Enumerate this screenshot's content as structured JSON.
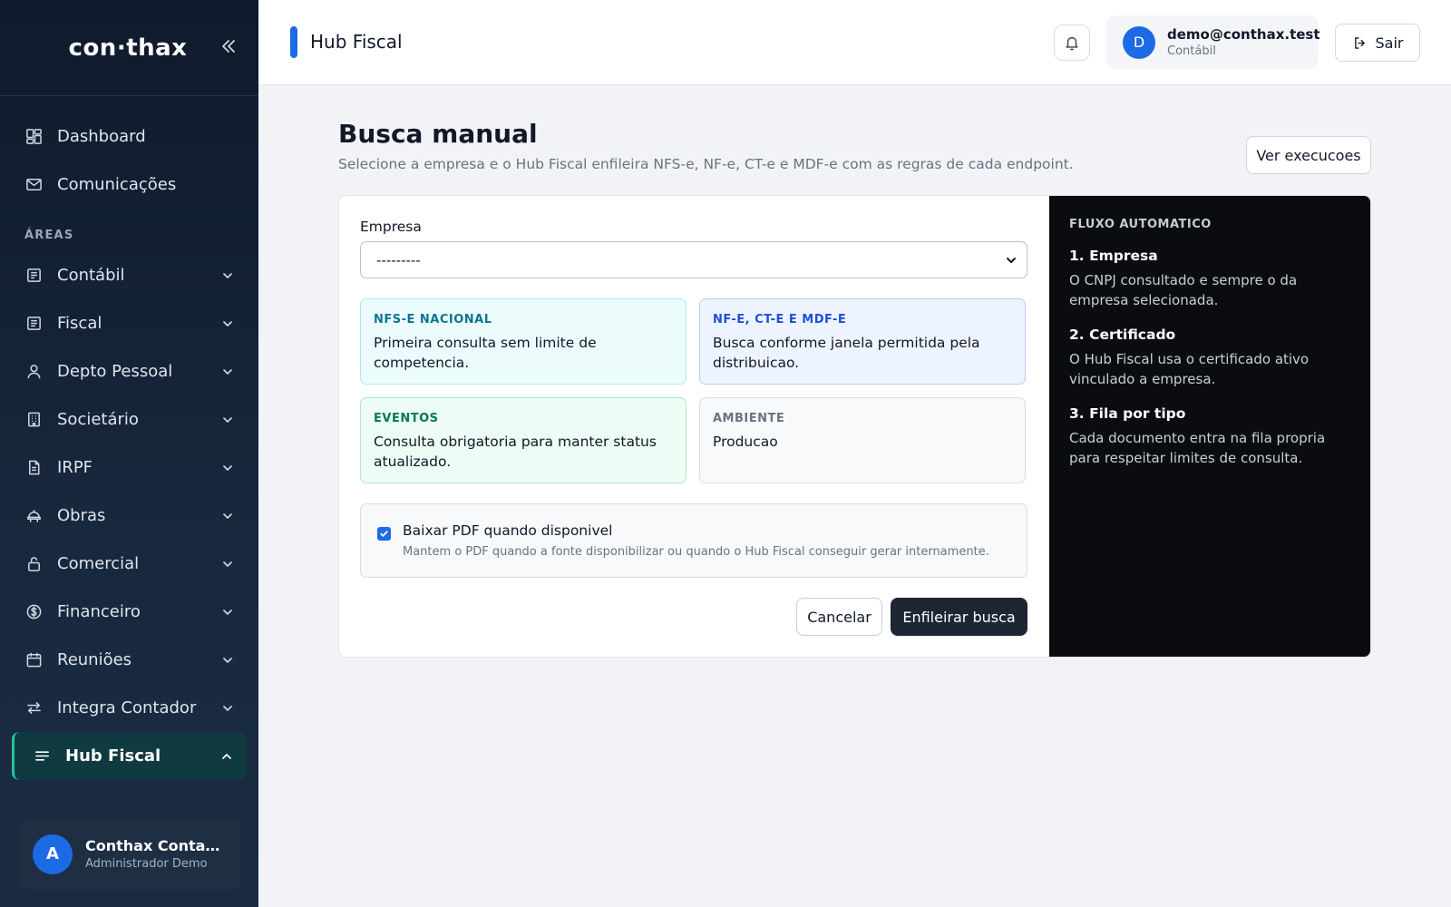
{
  "brand": {
    "logo": "con·thax"
  },
  "sidebar": {
    "top_items": [
      {
        "label": "Dashboard",
        "icon": "dashboard-icon"
      },
      {
        "label": "Comunicações",
        "icon": "mail-icon"
      }
    ],
    "section_label": "ÁREAS",
    "items": [
      {
        "label": "Contábil",
        "icon": "ledger-icon"
      },
      {
        "label": "Fiscal",
        "icon": "receipt-icon"
      },
      {
        "label": "Depto Pessoal",
        "icon": "user-icon"
      },
      {
        "label": "Societário",
        "icon": "building-icon"
      },
      {
        "label": "IRPF",
        "icon": "document-icon"
      },
      {
        "label": "Obras",
        "icon": "construction-icon"
      },
      {
        "label": "Comercial",
        "icon": "lock-icon"
      },
      {
        "label": "Financeiro",
        "icon": "dollar-icon"
      },
      {
        "label": "Reuniões",
        "icon": "calendar-icon"
      },
      {
        "label": "Integra Contador",
        "icon": "transfer-icon"
      }
    ],
    "active_item": {
      "label": "Hub Fiscal",
      "icon": "menu-lines-icon"
    },
    "user": {
      "initial": "A",
      "name": "Conthax Contabilidade",
      "role": "Administrador Demo"
    }
  },
  "topbar": {
    "title": "Hub Fiscal",
    "account": {
      "initial": "D",
      "email": "demo@conthax.test",
      "role": "Contábil"
    },
    "logout_label": "Sair"
  },
  "main": {
    "title": "Busca manual",
    "subtitle": "Selecione a empresa e o Hub Fiscal enfileira NFS-e, NF-e, CT-e e MDF-e com as regras de cada endpoint.",
    "ver_label": "Ver execucoes",
    "form": {
      "empresa_label": "Empresa",
      "empresa_value": "---------",
      "tiles": [
        {
          "title": "NFS-E NACIONAL",
          "desc": "Primeira consulta sem limite de competencia."
        },
        {
          "title": "NF-E, CT-E E MDF-E",
          "desc": "Busca conforme janela permitida pela distribuicao."
        },
        {
          "title": "EVENTOS",
          "desc": "Consulta obrigatoria para manter status atualizado."
        },
        {
          "title": "AMBIENTE",
          "desc": "Producao"
        }
      ],
      "pdf_title": "Baixar PDF quando disponivel",
      "pdf_desc": "Mantem o PDF quando a fonte disponibilizar ou quando o Hub Fiscal conseguir gerar internamente.",
      "pdf_checked": true,
      "cancel_label": "Cancelar",
      "submit_label": "Enfileirar busca"
    },
    "flow": {
      "heading": "FLUXO AUTOMATICO",
      "steps": [
        {
          "title": "1. Empresa",
          "desc": "O CNPJ consultado e sempre o da empresa selecionada."
        },
        {
          "title": "2. Certificado",
          "desc": "O Hub Fiscal usa o certificado ativo vinculado a empresa."
        },
        {
          "title": "3. Fila por tipo",
          "desc": "Cada documento entra na fila propria para respeitar limites de consulta."
        }
      ]
    }
  },
  "colors": {
    "primary": "#1d6ae5",
    "sidebar_bg": "#0f1a2c",
    "active_accent": "#23c4a0",
    "dark_button": "#1e2533"
  }
}
